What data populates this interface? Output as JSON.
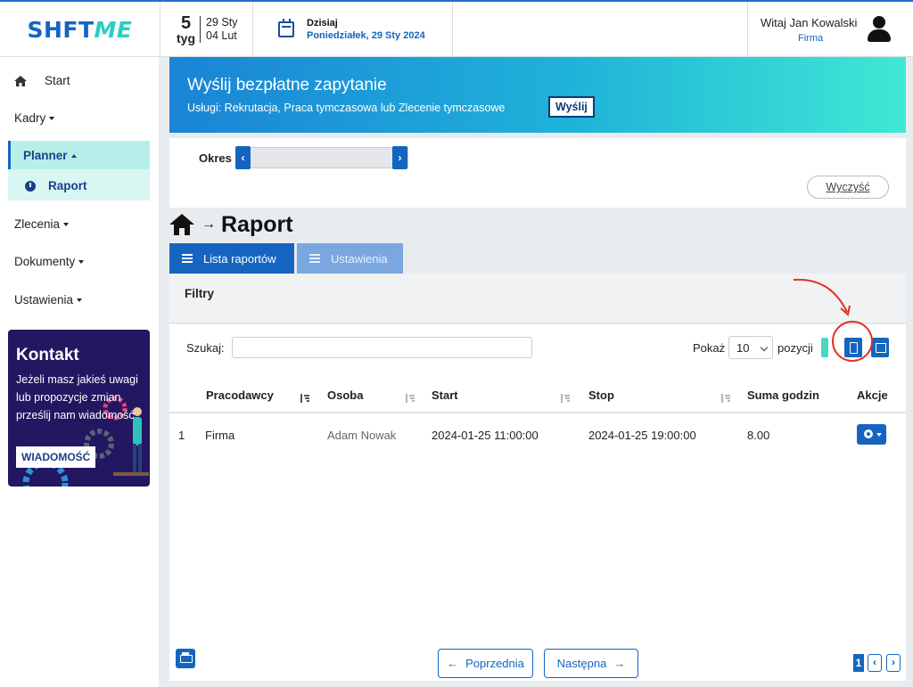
{
  "app": {
    "logo": {
      "main": "SHFT",
      "accent": "ME"
    },
    "week": {
      "number": "5",
      "unit": "tyg",
      "from": "29 Sty",
      "to": "04 Lut"
    },
    "today": {
      "label": "Dzisiaj",
      "date": "Poniedziałek, 29 Sty 2024"
    },
    "user": {
      "greeting": "Witaj Jan Kowalski",
      "company": "Firma"
    }
  },
  "sidebar": {
    "start": "Start",
    "kadry": "Kadry",
    "planner": "Planner",
    "raport": "Raport",
    "zlecenia": "Zlecenia",
    "dokumenty": "Dokumenty",
    "ustawienia": "Ustawienia",
    "kontakt": {
      "title": "Kontakt",
      "text": "Jeżeli masz jakieś uwagi lub propozycje zmian prześlij nam wiadomość",
      "button": "WIADOMOŚĆ"
    }
  },
  "banner": {
    "title": "Wyślij bezpłatne zapytanie",
    "subtitle": "Usługi: Rekrutacja, Praca tymczasowa lub Zlecenie tymczasowe",
    "button": "Wyślij"
  },
  "okres": {
    "label": "Okres",
    "clear": "Wyczyść"
  },
  "page": {
    "title": "Raport"
  },
  "tabs": [
    {
      "label": "Lista raportów",
      "active": true
    },
    {
      "label": "Ustawienia",
      "active": false
    }
  ],
  "filters": {
    "title": "Filtry"
  },
  "table_controls": {
    "search_label": "Szukaj:",
    "search_value": "",
    "show_label": "Pokaż",
    "page_size": "10",
    "entries_label": "pozycji"
  },
  "table": {
    "columns": [
      "Pracodawcy",
      "Osoba",
      "Start",
      "Stop",
      "Suma godzin",
      "Akcje"
    ],
    "rows": [
      {
        "index": "1",
        "employer": "Firma",
        "person": "Adam Nowak",
        "start": "2024-01-25 11:00:00",
        "stop": "2024-01-25 19:00:00",
        "hours": "8.00"
      }
    ]
  },
  "pagination": {
    "prev": "Poprzednia",
    "next": "Następna",
    "current_page": "1"
  },
  "colors": {
    "primary": "#1565c0",
    "accent": "#27d0c3",
    "highlight": "#e53023"
  }
}
